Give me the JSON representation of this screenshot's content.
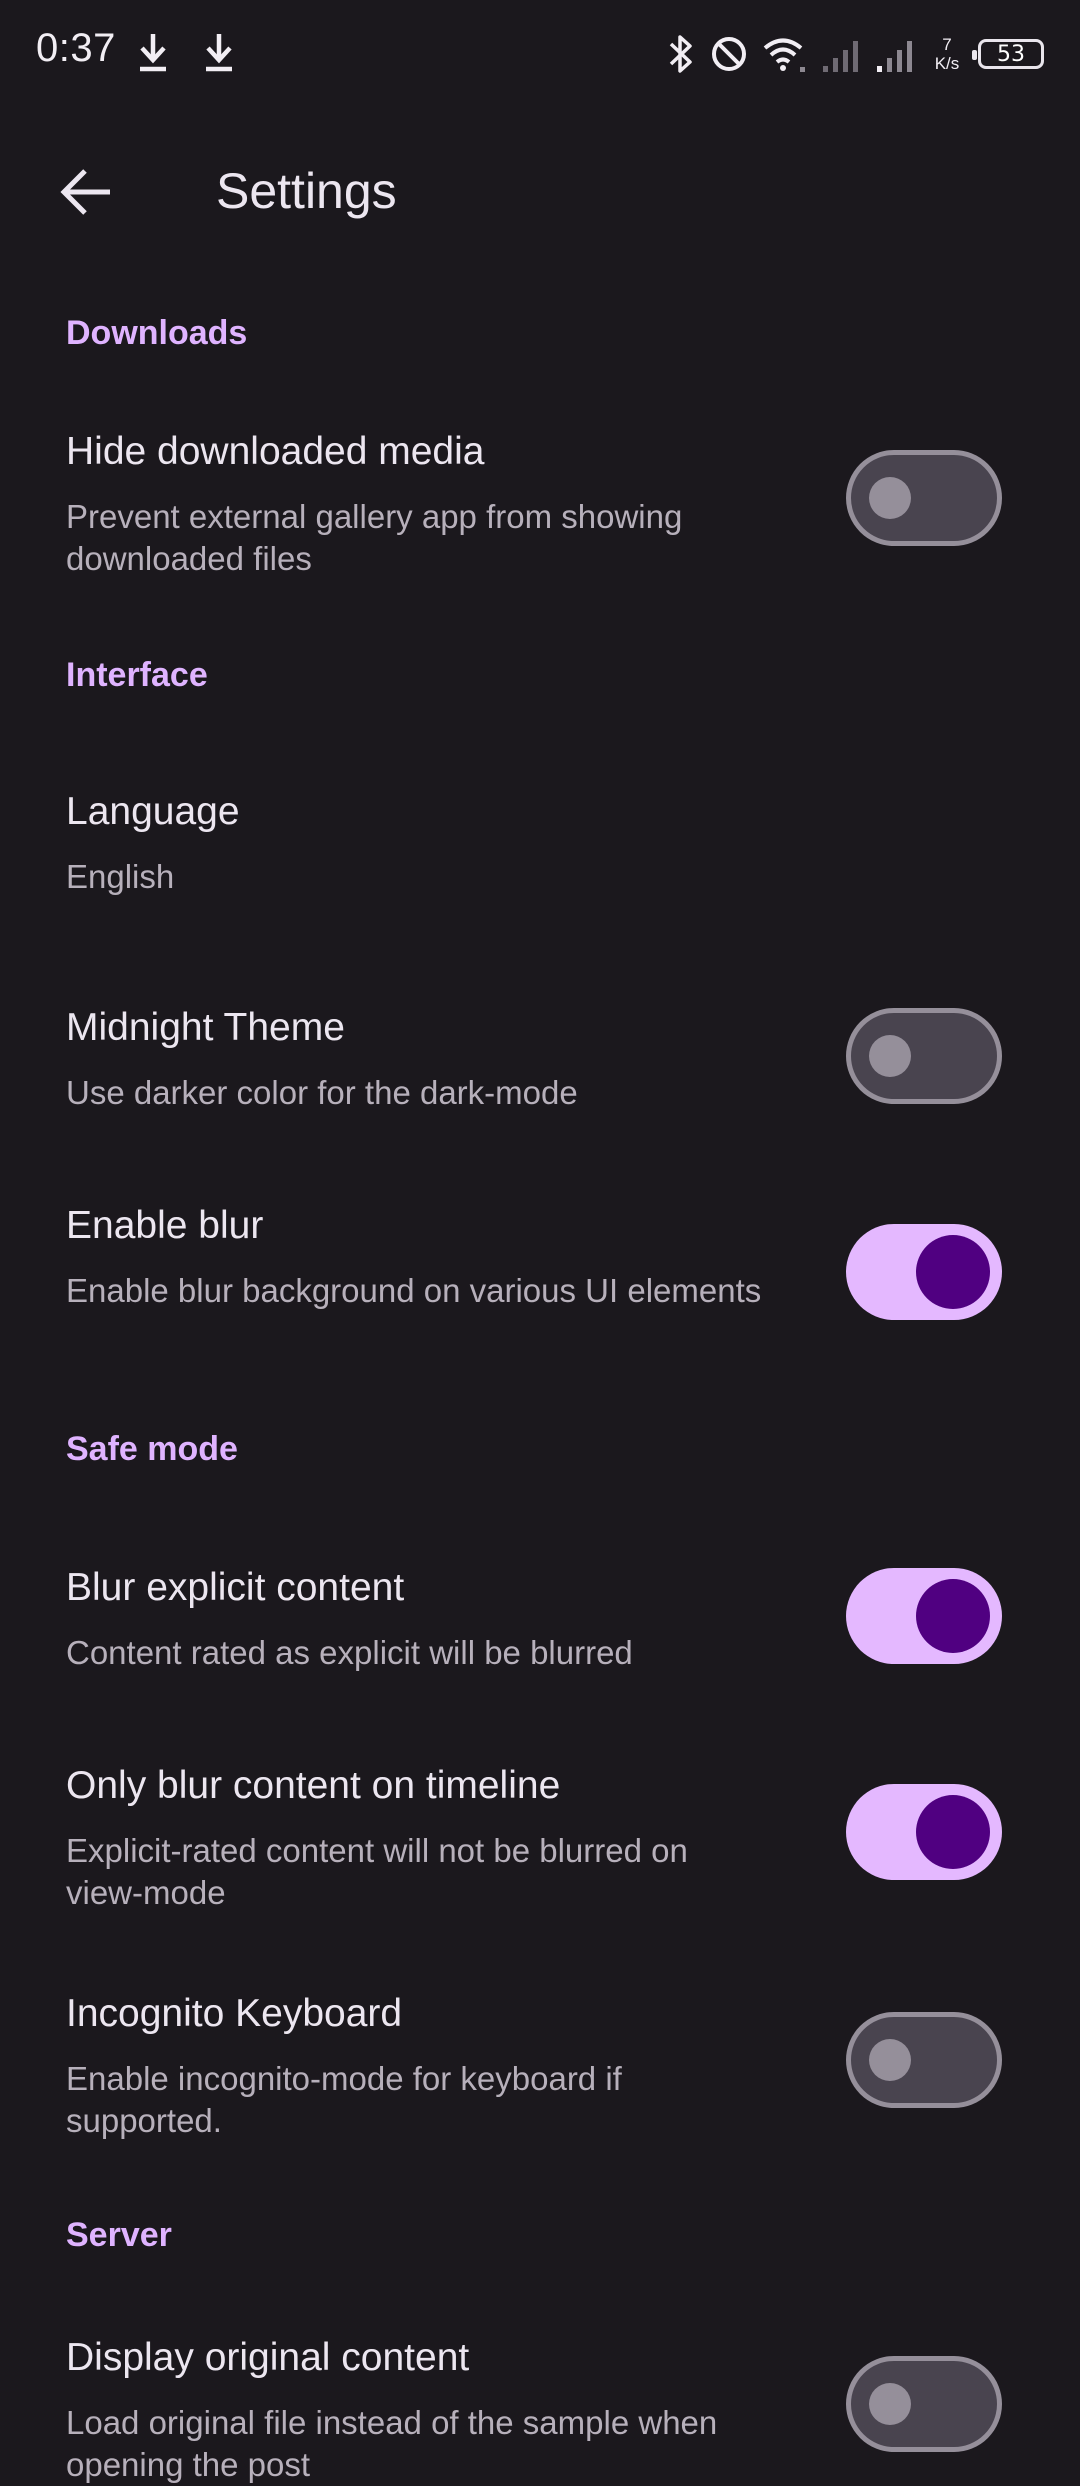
{
  "status_bar": {
    "time": "0:37",
    "icons": [
      "download-icon",
      "download-icon",
      "bluetooth-icon",
      "do-not-disturb-icon",
      "wifi-icon",
      "signal-icon",
      "signal-icon"
    ],
    "net_speed_value": "7",
    "net_speed_unit": "K/s",
    "battery_level": "53"
  },
  "app_bar": {
    "back_icon": "arrow-back-icon",
    "title": "Settings"
  },
  "sections": [
    {
      "header": "Downloads",
      "items": [
        {
          "title": "Hide downloaded media",
          "subtitle": "Prevent external gallery app from showing downloaded files",
          "toggle": false
        }
      ]
    },
    {
      "header": "Interface",
      "items": [
        {
          "title": "Language",
          "subtitle": "English"
        },
        {
          "title": "Midnight Theme",
          "subtitle": "Use darker color for the dark-mode",
          "toggle": false
        },
        {
          "title": "Enable blur",
          "subtitle": "Enable blur background on various UI elements",
          "toggle": true
        }
      ]
    },
    {
      "header": "Safe mode",
      "items": [
        {
          "title": "Blur explicit content",
          "subtitle": "Content rated as explicit will be blurred",
          "toggle": true
        },
        {
          "title": "Only blur content on timeline",
          "subtitle": "Explicit-rated content will not be blurred on view-mode",
          "toggle": true
        },
        {
          "title": "Incognito Keyboard",
          "subtitle": "Enable incognito-mode for keyboard if supported.",
          "toggle": false
        }
      ]
    },
    {
      "header": "Server",
      "items": [
        {
          "title": "Display original content",
          "subtitle": "Load original file instead of the sample when opening the post",
          "toggle": false
        }
      ]
    }
  ],
  "colors": {
    "background": "#1b181d",
    "accent": "#dfb3ff",
    "switch_on_track": "#e4b8ff",
    "switch_on_thumb": "#500081",
    "switch_off_track": "#49444f",
    "switch_off_outline": "#958f9a"
  }
}
